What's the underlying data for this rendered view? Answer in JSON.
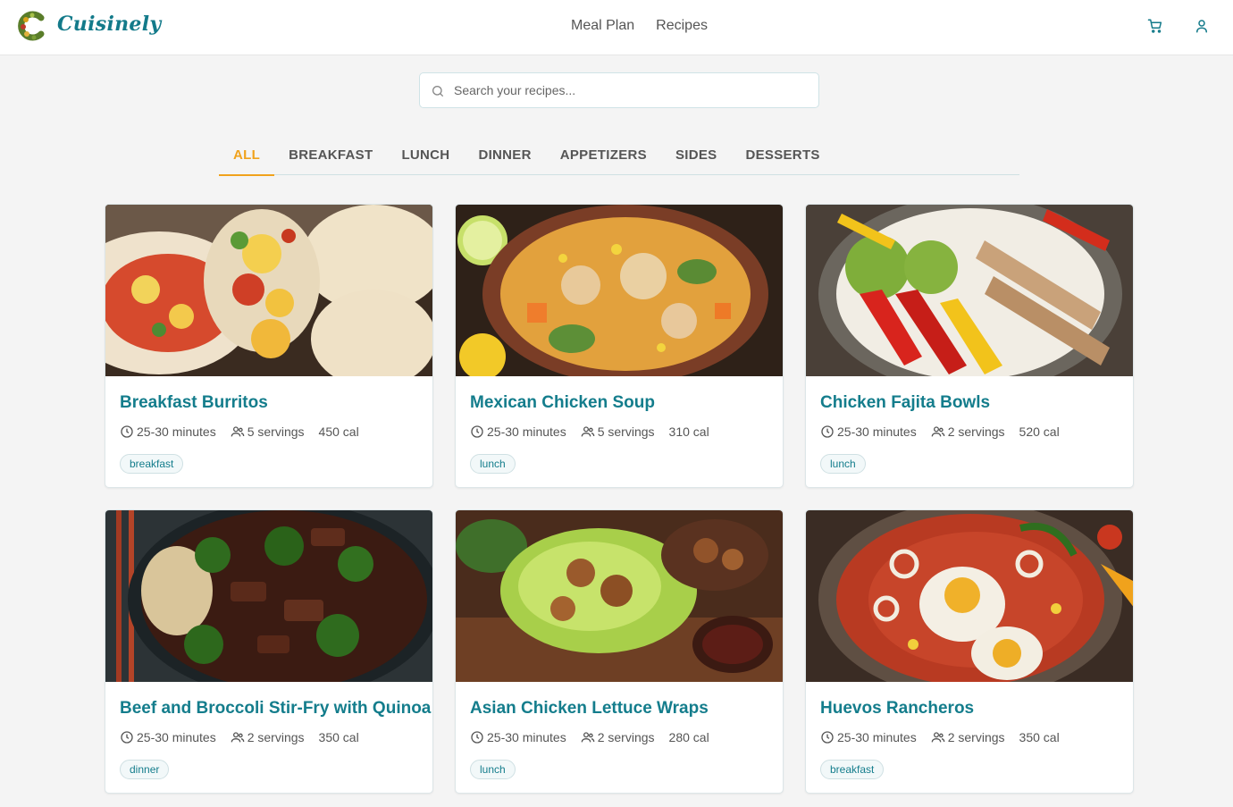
{
  "header": {
    "brand": "Cuisinely",
    "nav": [
      {
        "label": "Meal Plan"
      },
      {
        "label": "Recipes"
      }
    ],
    "icons": [
      "cart-icon",
      "user-icon"
    ]
  },
  "search": {
    "placeholder": "Search your recipes...",
    "value": ""
  },
  "tabs": [
    {
      "label": "ALL",
      "active": true
    },
    {
      "label": "BREAKFAST"
    },
    {
      "label": "LUNCH"
    },
    {
      "label": "DINNER"
    },
    {
      "label": "APPETIZERS"
    },
    {
      "label": "SIDES"
    },
    {
      "label": "DESSERTS"
    }
  ],
  "colors": {
    "accent": "#f0a21c",
    "brand": "#147d8c",
    "background": "#f4f4f4"
  },
  "recipes": [
    {
      "title": "Breakfast Burritos",
      "time": "25-30 minutes",
      "servings": "5 servings",
      "calories": "450 cal",
      "tag": "breakfast"
    },
    {
      "title": "Mexican Chicken Soup",
      "time": "25-30 minutes",
      "servings": "5 servings",
      "calories": "310 cal",
      "tag": "lunch"
    },
    {
      "title": "Chicken Fajita Bowls",
      "time": "25-30 minutes",
      "servings": "2 servings",
      "calories": "520 cal",
      "tag": "lunch"
    },
    {
      "title": "Beef and Broccoli Stir-Fry with Quinoa",
      "time": "25-30 minutes",
      "servings": "2 servings",
      "calories": "350 cal",
      "tag": "dinner"
    },
    {
      "title": "Asian Chicken Lettuce Wraps",
      "time": "25-30 minutes",
      "servings": "2 servings",
      "calories": "280 cal",
      "tag": "lunch"
    },
    {
      "title": "Huevos Rancheros",
      "time": "25-30 minutes",
      "servings": "2 servings",
      "calories": "350 cal",
      "tag": "breakfast"
    }
  ]
}
